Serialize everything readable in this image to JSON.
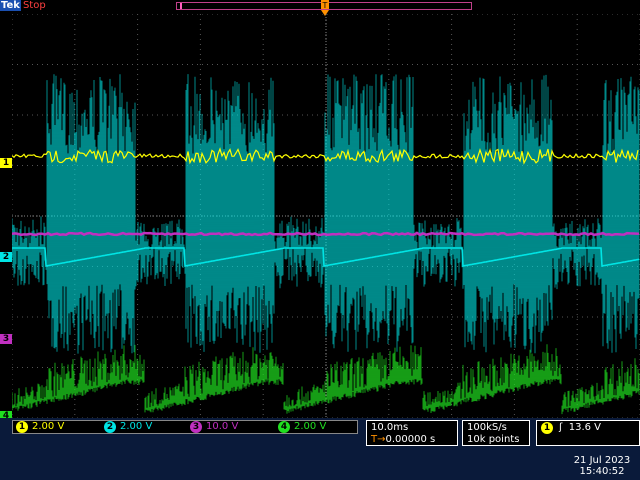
{
  "status": {
    "brand": "Tek",
    "run_state": "Stop"
  },
  "channels": [
    {
      "id": "1",
      "scale": "2.00 V",
      "color": "#ffff00"
    },
    {
      "id": "2",
      "scale": "2.00 V",
      "color": "#00e5e5"
    },
    {
      "id": "3",
      "scale": "10.0 V",
      "color": "#c030c0"
    },
    {
      "id": "4",
      "scale": "2.00 V",
      "color": "#20e020"
    }
  ],
  "horizontal": {
    "time_div": "10.0ms",
    "delay": "0.00000 s",
    "delay_prefix": "T→"
  },
  "acquisition": {
    "sample_rate": "100kS/s",
    "record_length": "10k points"
  },
  "trigger": {
    "source": "1",
    "slope_icon": "rising-edge-icon",
    "slope_glyph": "ʃ",
    "level": "13.6 V"
  },
  "datetime": {
    "date": "21 Jul  2023",
    "time": "15:40:52"
  },
  "chart_data": {
    "type": "line",
    "title": "",
    "xlabel": "",
    "ylabel": "",
    "grid": true,
    "x_divisions": 10,
    "y_divisions": 8,
    "series": [
      {
        "channel": "1",
        "description": "burst waveform around 13.6 V level",
        "color": "#ffff00"
      },
      {
        "channel": "2",
        "description": "switching bursts with sawtooth ramps, period ~20 ms",
        "color": "#00e5e5"
      },
      {
        "channel": "3",
        "description": "flat DC level",
        "color": "#c030c0"
      },
      {
        "channel": "4",
        "description": "noisy sawtooth ramps, period ~20 ms",
        "color": "#20e020"
      }
    ]
  }
}
